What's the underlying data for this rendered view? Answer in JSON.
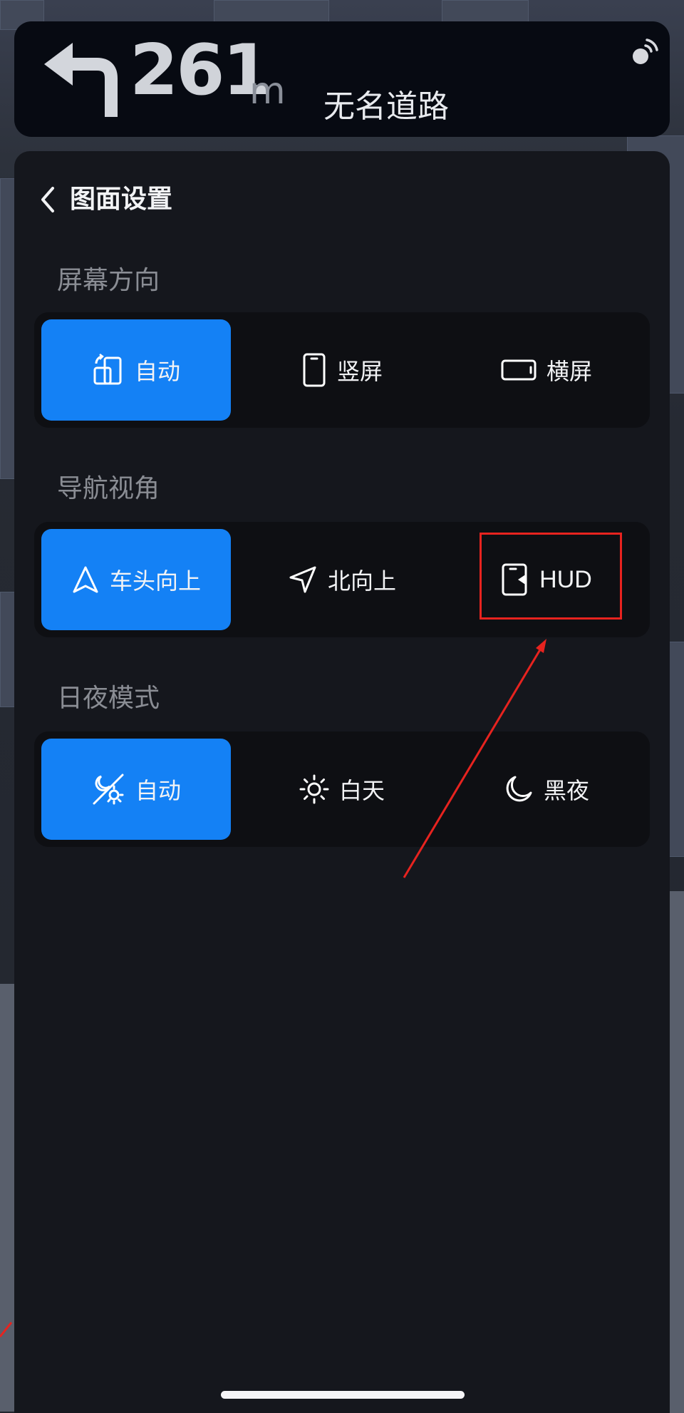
{
  "nav_banner": {
    "distance_value": "261",
    "distance_unit": "m",
    "road_name": "无名道路",
    "turn_icon": "turn-left-arrow-icon",
    "signal_icon": "satellite-signal-icon"
  },
  "settings": {
    "title": "图面设置",
    "back_icon": "chevron-left-icon",
    "sections": [
      {
        "title": "屏幕方向",
        "options": [
          {
            "label": "自动",
            "icon": "auto-rotate-icon",
            "selected": true
          },
          {
            "label": "竖屏",
            "icon": "portrait-phone-icon",
            "selected": false
          },
          {
            "label": "横屏",
            "icon": "landscape-phone-icon",
            "selected": false
          }
        ]
      },
      {
        "title": "导航视角",
        "options": [
          {
            "label": "车头向上",
            "icon": "heading-up-arrow-icon",
            "selected": true
          },
          {
            "label": "北向上",
            "icon": "north-up-arrow-icon",
            "selected": false
          },
          {
            "label": "HUD",
            "icon": "hud-phone-icon",
            "selected": false
          }
        ]
      },
      {
        "title": "日夜模式",
        "options": [
          {
            "label": "自动",
            "icon": "auto-day-night-icon",
            "selected": true
          },
          {
            "label": "白天",
            "icon": "sun-icon",
            "selected": false
          },
          {
            "label": "黑夜",
            "icon": "moon-icon",
            "selected": false
          }
        ]
      }
    ]
  },
  "colors": {
    "accent": "#1481f5",
    "panel_bg": "#15171d",
    "segment_bg": "#0e0f13",
    "annotation": "#e7231f"
  }
}
